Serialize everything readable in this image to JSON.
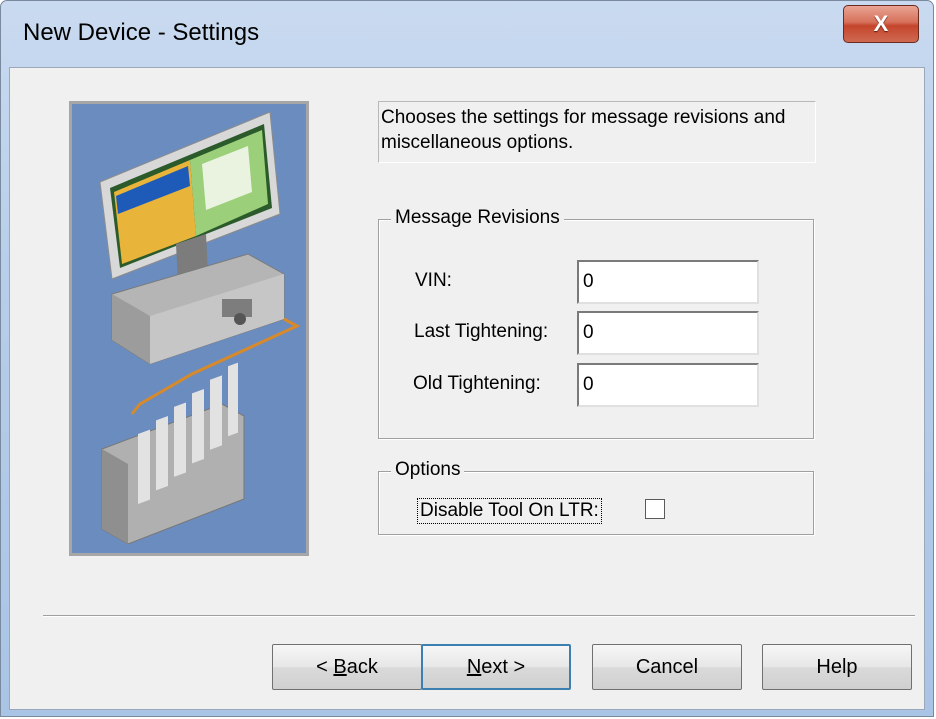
{
  "window": {
    "title": "New Device - Settings",
    "close_glyph": "X"
  },
  "description": "Chooses the settings for message revisions and miscellaneous options.",
  "message_revisions": {
    "legend": "Message Revisions",
    "vin_label": "VIN:",
    "vin_value": "0",
    "last_tightening_label": "Last Tightening:",
    "last_tightening_value": "0",
    "old_tightening_label": "Old Tightening:",
    "old_tightening_value": "0"
  },
  "options": {
    "legend": "Options",
    "disable_tool_label": "Disable Tool On LTR:",
    "disable_tool_checked": false
  },
  "buttons": {
    "back_prefix": "< ",
    "back_mnemonic": "B",
    "back_rest": "ack",
    "next_mnemonic": "N",
    "next_rest": "ext >",
    "cancel": "Cancel",
    "help": "Help"
  },
  "colors": {
    "title_bar": "#b7cde9",
    "close_button": "#c4452b",
    "client_bg": "#f0f0f0",
    "default_button_border": "#3c7fb1"
  },
  "icons": {
    "illustration": "computer-and-plc-illustration",
    "close": "close-icon"
  }
}
